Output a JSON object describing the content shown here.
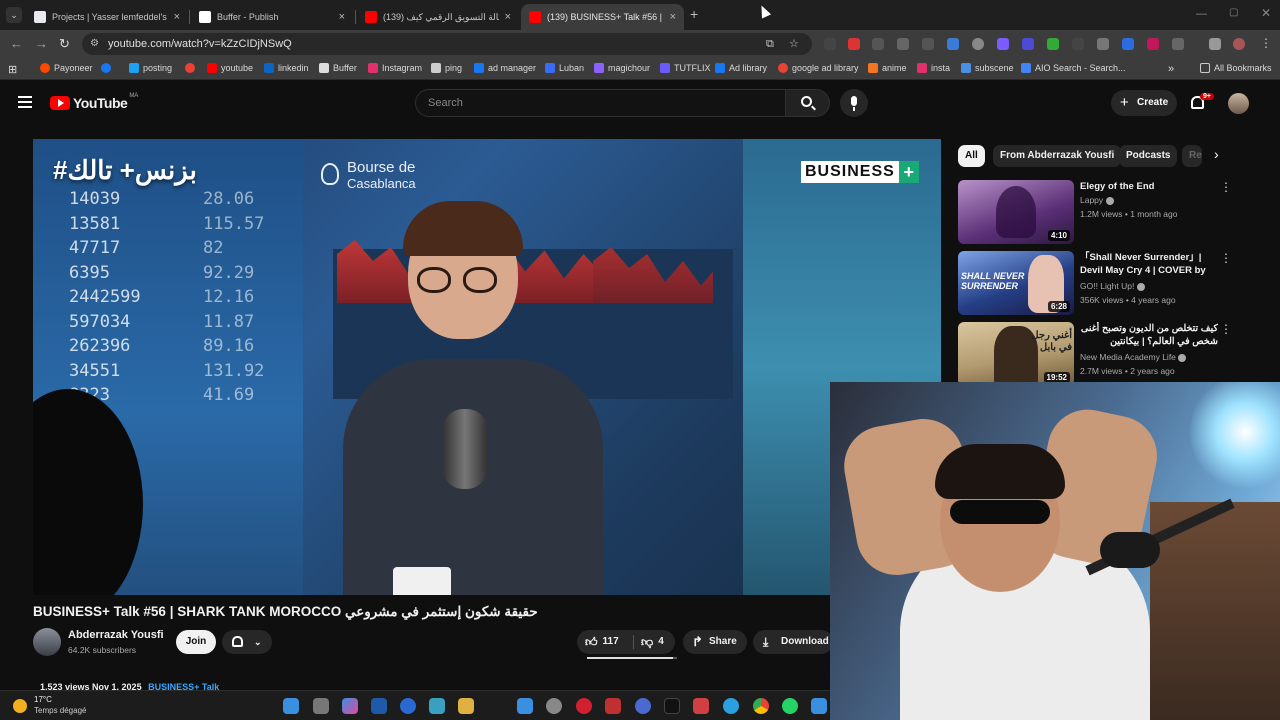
{
  "browser": {
    "tabs": [
      {
        "title": "Projects | Yasser lemfeddel's W",
        "color": "#e8eaed",
        "active": false
      },
      {
        "title": "Buffer - Publish",
        "color": "#ffffff",
        "active": false
      },
      {
        "title": "(139) وكالة التسويق الرقمي كيف",
        "color": "#ff0000",
        "active": false
      },
      {
        "title": "(139) BUSINESS+ Talk #56 | SH",
        "color": "#ff0000",
        "active": true
      }
    ],
    "url": "youtube.com/watch?v=kZzCIDjNSwQ",
    "bookmarks": [
      {
        "label": "Payoneer",
        "color": "#ff4800"
      },
      {
        "label": "",
        "color": "#1877f2"
      },
      {
        "label": "posting",
        "color": "#1da1f2"
      },
      {
        "label": "",
        "color": "#ea4335"
      },
      {
        "label": "youtube",
        "color": "#ff0000"
      },
      {
        "label": "linkedin",
        "color": "#0a66c2"
      },
      {
        "label": "Buffer",
        "color": "#dddddd"
      },
      {
        "label": "Instagram",
        "color": "#e1306c"
      },
      {
        "label": "ping",
        "color": "#cccccc"
      },
      {
        "label": "ad manager",
        "color": "#1877f2"
      },
      {
        "label": "Luban",
        "color": "#3b6cf6"
      },
      {
        "label": "magichour",
        "color": "#8a63ff"
      },
      {
        "label": "TUTFLIX",
        "color": "#6b5bff"
      },
      {
        "label": "Ad library",
        "color": "#1877f2"
      },
      {
        "label": "google ad library",
        "color": "#ea4335"
      },
      {
        "label": "anime",
        "color": "#f47521"
      },
      {
        "label": "insta",
        "color": "#e1306c"
      },
      {
        "label": "subscene",
        "color": "#4a90e2"
      },
      {
        "label": "AIO Search - Search...",
        "color": "#4285f4"
      }
    ],
    "all_bookmarks": "All Bookmarks"
  },
  "youtube": {
    "logo": "YouTube",
    "region": "MA",
    "search_placeholder": "Search",
    "create_label": "Create",
    "notif_count": "9+"
  },
  "player": {
    "overlay_ar": "#بزنس+ تالك",
    "brand": "BUSINESS",
    "bourse_line1": "Bourse de",
    "bourse_line2": "Casablanca",
    "numbers": [
      "14039",
      "13581",
      "47717",
      "6395",
      "2442599",
      "597034",
      "262396",
      "34551",
      "8323"
    ],
    "numbers2": [
      "28.06",
      "115.57",
      "82",
      "92.29",
      "12.16",
      "11.87",
      "89.16",
      "131.92",
      "41.69"
    ]
  },
  "video": {
    "title": "BUSINESS+ Talk #56 | SHARK TANK MOROCCO حقيقة شكون إستثمر في مشروعي",
    "channel": "Abderrazak Yousfi",
    "subscribers": "64.2K subscribers",
    "join": "Join",
    "likes": "117",
    "dislikes": "4",
    "share": "Share",
    "download": "Download",
    "views_date": "1,523 views  Nov 1, 2025",
    "hashtag": "BUSINESS+ Talk"
  },
  "chips": [
    "All",
    "From Abderrazak Yousfi",
    "Podcasts",
    "Re"
  ],
  "recommendations": [
    {
      "title": "Elegy of the End",
      "channel": "Lappy",
      "meta": "1.2M views • 1 month ago",
      "duration": "4:10",
      "thumb": "#6b3f8a"
    },
    {
      "title": "「Shall Never Surrender」| Devil May Cry 4 | COVER by G...",
      "channel": "GO!! Light Up!",
      "meta": "356K views • 4 years ago",
      "duration": "6:28",
      "thumb": "#233a78",
      "thumb_text": "SHALL NEVER SURRENDER"
    },
    {
      "title": "كيف تتخلص من الديون وتصبح أغنى شخص في العالم؟ | بيكانتين",
      "channel": "New Media Academy Life",
      "meta": "2.7M views • 2 years ago",
      "duration": "19:52",
      "thumb": "#c9b38a",
      "thumb_text": "أغني رجل في بابل"
    }
  ],
  "taskbar": {
    "temp": "17°C",
    "weather": "Temps dégagé"
  }
}
